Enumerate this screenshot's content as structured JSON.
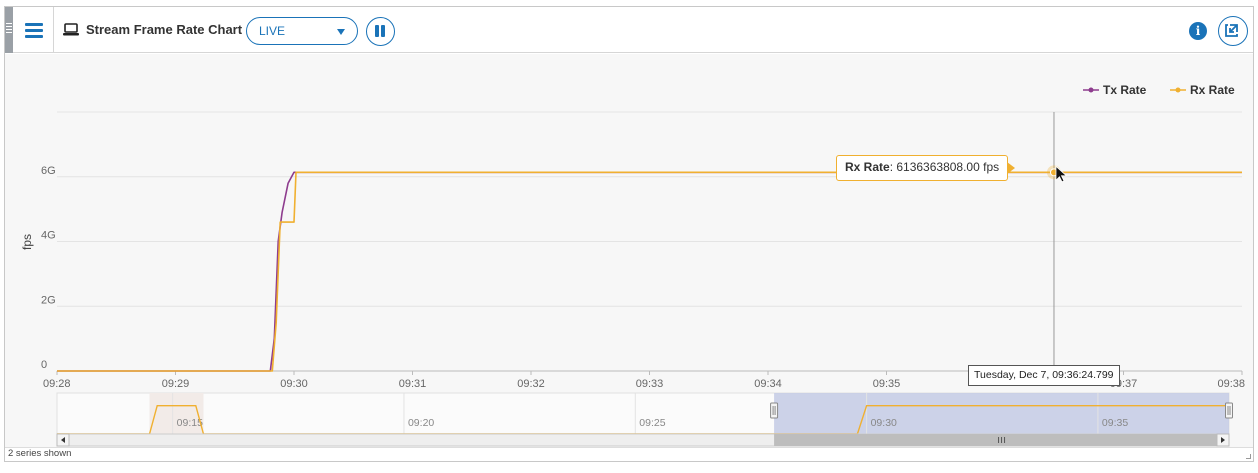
{
  "toolbar": {
    "title": "Stream Frame Rate Chart",
    "mode": {
      "value": "LIVE",
      "icon": "chevron-down-icon"
    },
    "menu_icon": "hamburger-icon",
    "title_icon": "laptop-icon",
    "pause_icon": "pause-icon",
    "info_icon": "info-icon",
    "popout_icon": "popout-icon"
  },
  "colors": {
    "accent": "#1a73b8",
    "tx": "#8e3c8e",
    "rx": "#f0b030",
    "background": "#f7f7f7"
  },
  "chart_data": {
    "type": "line",
    "title": "",
    "ylabel": "fps",
    "xlabel": "",
    "ylim": [
      0,
      8000000000
    ],
    "y_ticks": [
      {
        "value": 0,
        "label": "0"
      },
      {
        "value": 2000000000,
        "label": "2G"
      },
      {
        "value": 4000000000,
        "label": "4G"
      },
      {
        "value": 6000000000,
        "label": "6G"
      }
    ],
    "x_ticks": [
      "09:28",
      "09:29",
      "09:30",
      "09:31",
      "09:32",
      "09:33",
      "09:34",
      "09:35",
      "09:36",
      "09:37",
      "09:38"
    ],
    "x_ticks_visible": [
      "09:28",
      "09:29",
      "09:30",
      "09:31",
      "09:32",
      "09:33",
      "09:34",
      "09:35",
      "09:37",
      "09:38"
    ],
    "xlim": [
      "09:28:00",
      "09:38:00"
    ],
    "legend": {
      "position": "top-right",
      "items": [
        {
          "name": "Tx Rate"
        },
        {
          "name": "Rx Rate"
        }
      ]
    },
    "grid": true,
    "series": [
      {
        "name": "Tx Rate",
        "points": [
          [
            "09:28:00",
            0
          ],
          [
            "09:29:48",
            0
          ],
          [
            "09:29:50",
            1000000000
          ],
          [
            "09:29:52",
            4000000000
          ],
          [
            "09:29:54",
            4900000000
          ],
          [
            "09:29:57",
            5800000000
          ],
          [
            "09:30:00",
            6136363808
          ],
          [
            "09:38:00",
            6136363808
          ]
        ]
      },
      {
        "name": "Rx Rate",
        "points": [
          [
            "09:28:00",
            0
          ],
          [
            "09:29:49",
            0
          ],
          [
            "09:29:51",
            1500000000
          ],
          [
            "09:29:53",
            4600000000
          ],
          [
            "09:29:56",
            4600000000
          ],
          [
            "09:30:00",
            4600000000
          ],
          [
            "09:30:01",
            6136363808
          ],
          [
            "09:38:00",
            6136363808
          ]
        ]
      }
    ],
    "tooltip": {
      "series": "Rx Rate",
      "label": "Rx Rate",
      "value_text": "6136363808.00 fps",
      "x": "09:36:24.799",
      "time_text": "Tuesday, Dec 7, 09:36:24.799"
    },
    "navigator": {
      "ticks": [
        "09:15",
        "09:20",
        "09:25",
        "09:30",
        "09:35"
      ],
      "xlim": [
        "09:12:30",
        "09:37:50"
      ],
      "selected_range": [
        "09:28:00",
        "09:38:00"
      ],
      "points": [
        [
          "09:12:30",
          0
        ],
        [
          "09:14:30",
          0
        ],
        [
          "09:14:40",
          6136363808
        ],
        [
          "09:15:30",
          6136363808
        ],
        [
          "09:15:40",
          0
        ],
        [
          "09:29:48",
          0
        ],
        [
          "09:30:00",
          6136363808
        ],
        [
          "09:37:50",
          6136363808
        ]
      ]
    }
  },
  "status": {
    "text": "2 series shown"
  }
}
